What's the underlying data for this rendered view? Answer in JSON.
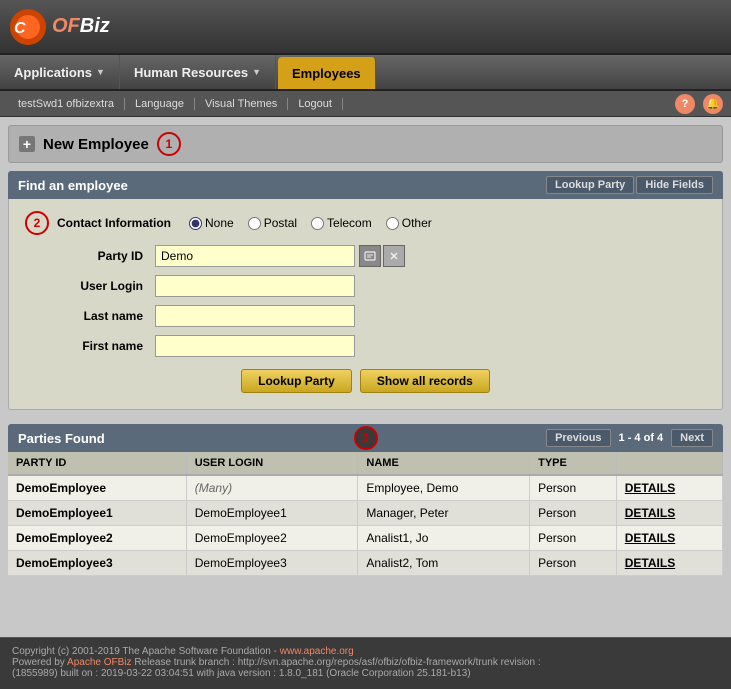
{
  "logo": {
    "text_of": "OFBiz",
    "text_prefix": "C"
  },
  "nav": {
    "items": [
      {
        "id": "applications",
        "label": "Applications",
        "active": false
      },
      {
        "id": "human-resources",
        "label": "Human Resources",
        "active": false
      },
      {
        "id": "employees",
        "label": "Employees",
        "active": true
      }
    ]
  },
  "subnav": {
    "user": "testSwd1 ofbizextra",
    "language": "Language",
    "visual_themes": "Visual Themes",
    "logout": "Logout"
  },
  "new_employee": {
    "button_label": "New Employee",
    "step_number": "1"
  },
  "find_bar": {
    "title": "Find an employee",
    "lookup_party": "Lookup Party",
    "hide_fields": "Hide Fields"
  },
  "form": {
    "contact_label": "Contact Information",
    "contact_options": [
      "None",
      "Postal",
      "Telecom",
      "Other"
    ],
    "contact_selected": "None",
    "fields": [
      {
        "id": "party-id",
        "label": "Party ID",
        "value": "Demo",
        "placeholder": ""
      },
      {
        "id": "user-login",
        "label": "User Login",
        "value": "",
        "placeholder": ""
      },
      {
        "id": "last-name",
        "label": "Last name",
        "value": "",
        "placeholder": ""
      },
      {
        "id": "first-name",
        "label": "First name",
        "value": "",
        "placeholder": ""
      }
    ],
    "step_number": "2",
    "lookup_party_btn": "Lookup Party",
    "show_all_btn": "Show all records"
  },
  "parties": {
    "title": "Parties Found",
    "step_number": "3",
    "nav": {
      "previous": "Previous",
      "range": "1 - 4 of 4",
      "next": "Next"
    },
    "columns": [
      "PARTY ID",
      "USER LOGIN",
      "NAME",
      "TYPE",
      ""
    ],
    "rows": [
      {
        "party_id": "DemoEmployee",
        "user_login": "(Many)",
        "name": "Employee, Demo",
        "type": "Person",
        "details": "DETAILS"
      },
      {
        "party_id": "DemoEmployee1",
        "user_login": "DemoEmployee1",
        "name": "Manager, Peter",
        "type": "Person",
        "details": "DETAILS"
      },
      {
        "party_id": "DemoEmployee2",
        "user_login": "DemoEmployee2",
        "name": "Analist1, Jo",
        "type": "Person",
        "details": "DETAILS"
      },
      {
        "party_id": "DemoEmployee3",
        "user_login": "DemoEmployee3",
        "name": "Analist2, Tom",
        "type": "Person",
        "details": "DETAILS"
      }
    ]
  },
  "footer": {
    "line1": "Copyright (c) 2001-2019 The Apache Software Foundation - ",
    "link1": "www.apache.org",
    "line2": "Powered by ",
    "link2": "Apache OFBiz",
    "line2b": " Release trunk branch : http://svn.apache.org/repos/asf/ofbiz/ofbiz-framework/trunk revision :",
    "line3": "(1855989) built on : 2019-03-22 03:04:51 with java version : 1.8.0_181 (Oracle Corporation 25.181-b13)"
  }
}
